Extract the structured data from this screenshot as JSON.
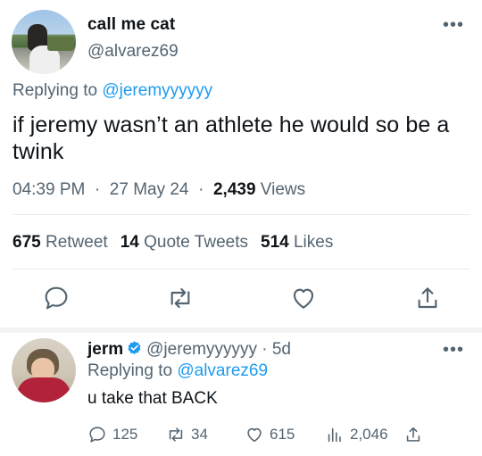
{
  "main_tweet": {
    "display_name": "call me cat",
    "handle": "@alvarez69",
    "replying_prefix": "Replying to ",
    "replying_to": "@jeremyyyyyy",
    "text": "if jeremy wasn’t an athlete he would so be a twink",
    "time": "04:39 PM",
    "date": "27 May 24",
    "views_count": "2,439",
    "views_label": "Views",
    "retweets_count": "675",
    "retweets_label": "Retweet",
    "quotes_count": "14",
    "quotes_label": "Quote Tweets",
    "likes_count": "514",
    "likes_label": "Likes",
    "more_label": "•••"
  },
  "reply_tweet": {
    "display_name": "jerm",
    "handle": "@jeremyyyyyy",
    "age": "5d",
    "replying_prefix": "Replying to ",
    "replying_to": "@alvarez69",
    "text": "u take that BACK",
    "replies": "125",
    "retweets": "34",
    "likes": "615",
    "views": "2,046",
    "more_label": "•••"
  },
  "colors": {
    "accent": "#1d9bf0",
    "text": "#0f1419",
    "secondary": "#536471",
    "divider": "#e6ecf0"
  },
  "icons": [
    "reply-icon",
    "retweet-icon",
    "like-icon",
    "share-icon",
    "verified-icon",
    "views-icon",
    "more-icon"
  ]
}
